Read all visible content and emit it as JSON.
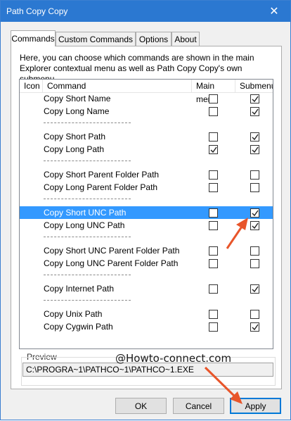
{
  "window": {
    "title": "Path Copy Copy",
    "close_glyph": "✕"
  },
  "tabs": [
    {
      "label": "Commands",
      "active": true
    },
    {
      "label": "Custom Commands",
      "active": false
    },
    {
      "label": "Options",
      "active": false
    },
    {
      "label": "About",
      "active": false
    }
  ],
  "description": "Here, you can choose which commands are shown in the main Explorer contextual menu as well as Path Copy Copy's own submenu.",
  "list": {
    "columns": {
      "icon": "Icon",
      "command": "Command",
      "main_menu": "Main menu",
      "submenu": "Submenu"
    },
    "rows": [
      {
        "label": "Copy Short Name",
        "main": false,
        "sub": true
      },
      {
        "label": "Copy Long Name",
        "main": false,
        "sub": true
      },
      {
        "label": "Copy Short Path",
        "main": false,
        "sub": true
      },
      {
        "label": "Copy Long Path",
        "main": true,
        "sub": true
      },
      {
        "label": "Copy Short Parent Folder Path",
        "main": false,
        "sub": false
      },
      {
        "label": "Copy Long Parent Folder Path",
        "main": false,
        "sub": false
      },
      {
        "label": "Copy Short UNC Path",
        "main": false,
        "sub": true,
        "selected": true
      },
      {
        "label": "Copy Long UNC Path",
        "main": false,
        "sub": true
      },
      {
        "label": "Copy Short UNC Parent Folder Path",
        "main": false,
        "sub": false
      },
      {
        "label": "Copy Long UNC Parent Folder Path",
        "main": false,
        "sub": false
      },
      {
        "label": "Copy Internet Path",
        "main": false,
        "sub": true
      },
      {
        "label": "Copy Unix Path",
        "main": false,
        "sub": false
      },
      {
        "label": "Copy Cygwin Path",
        "main": false,
        "sub": true
      }
    ]
  },
  "preview": {
    "label": "Preview",
    "value": "C:\\PROGRA~1\\PATHCO~1\\PATHCO~1.EXE"
  },
  "buttons": {
    "ok": "OK",
    "cancel": "Cancel",
    "apply": "Apply"
  },
  "watermark": "@Howto-connect.com",
  "colors": {
    "title_bar": "#2b78d1",
    "selection": "#3399ff",
    "annotation_arrow": "#e8552a"
  }
}
